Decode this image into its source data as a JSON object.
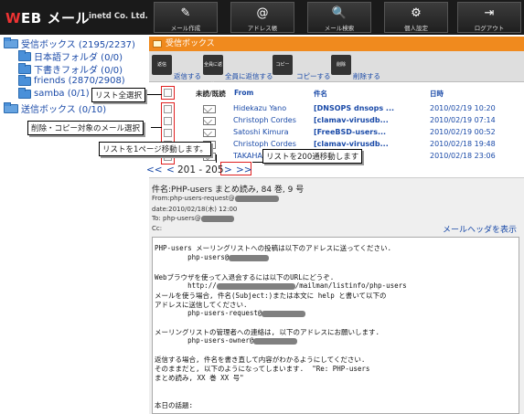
{
  "app": {
    "logo_w": "W",
    "logo_rest": "EB メール",
    "company": "inetd Co. Ltd."
  },
  "nav": [
    {
      "label": "メール作成",
      "icon": "compose-icon",
      "glyph": "✎"
    },
    {
      "label": "アドレス帳",
      "icon": "address-book-icon",
      "glyph": "@"
    },
    {
      "label": "メール検索",
      "icon": "mail-search-icon",
      "glyph": "🔍"
    },
    {
      "label": "個人設定",
      "icon": "settings-icon",
      "glyph": "⚙"
    },
    {
      "label": "ログアウト",
      "icon": "logout-icon",
      "glyph": "⇥"
    }
  ],
  "folders": [
    {
      "label": "受信ボックス (2195/2237)",
      "level": 0
    },
    {
      "label": "日本語フォルダ (0/0)",
      "level": 1
    },
    {
      "label": "下書きフォルダ (0/0)",
      "level": 1
    },
    {
      "label": "friends (2870/2908)",
      "level": 1
    },
    {
      "label": "samba (0/1)",
      "level": 1
    },
    {
      "label": "送信ボックス (0/10)",
      "level": 0
    }
  ],
  "pane": {
    "title": "受信ボックス"
  },
  "toolbar": {
    "reply": "返信する",
    "reply_icon_text": "返信",
    "reply_all": "全員に返信する",
    "reply_all_icon_text": "全員に返信",
    "copy": "コピーする",
    "copy_icon_text": "コピー",
    "delete": "削除する",
    "delete_icon_text": "削除"
  },
  "columns": {
    "unread": "未読/既読",
    "from": "From",
    "subject": "件名",
    "date": "日時"
  },
  "messages": [
    {
      "from": "Hidekazu Yano",
      "subject": "[DNSOPS dnsops ...",
      "date": "2010/02/19 10:20"
    },
    {
      "from": "Christoph Cordes",
      "subject": "[clamav-virusdb...",
      "date": "2010/02/19 07:14"
    },
    {
      "from": "Satoshi Kimura",
      "subject": "[FreeBSD-users...",
      "date": "2010/02/19 00:52"
    },
    {
      "from": "Christoph Cordes",
      "subject": "[clamav-virusdb...",
      "date": "2010/02/18 19:48"
    },
    {
      "from": "TAKAHASHI",
      "subject": "[...",
      "date": "2010/02/18 23:06"
    }
  ],
  "callouts": {
    "select_all": "リスト全選択",
    "select_target": "削除・コピー対象のメール選択",
    "page_move": "リストを1ページ移動します。",
    "move_200": "リストを200通移動します"
  },
  "pager": {
    "first": "<<",
    "prev": "<",
    "range": "201 - 205",
    "next": ">",
    "next200": ">>"
  },
  "preview": {
    "subject_line": "件名:PHP-users まとめ読み, 84 巻, 9 号",
    "from_line": "From:php-users-request@",
    "date_line": "date:2010/02/18(木) 12:00",
    "to_line": "To: php-users@",
    "cc_line": "Cc:",
    "show_headers": "メールヘッダを表示",
    "body": [
      "PHP-users メーリングリストへの投稿は以下のアドレスに送ってください.",
      "        php-users@",
      "",
      "Webブラウザを使って入退会するには以下のURLにどうぞ.",
      "        http://",
      "メールを使う場合, 件名(Subject:)または本文に help と書いて以下の",
      "アドレスに送信してください.",
      "        php-users-request@",
      "",
      "メーリングリストの管理者への連絡は, 以下のアドレスにお願いします.",
      "        php-users-owner@",
      "",
      "返信する場合, 件名を書き直して内容がわかるようにしてください.",
      "そのままだと, 以下のようになってしまいます.  \"Re: PHP-users",
      "まとめ読み, XX 巻 XX 号\"",
      "",
      "",
      "本日の話題:"
    ]
  }
}
